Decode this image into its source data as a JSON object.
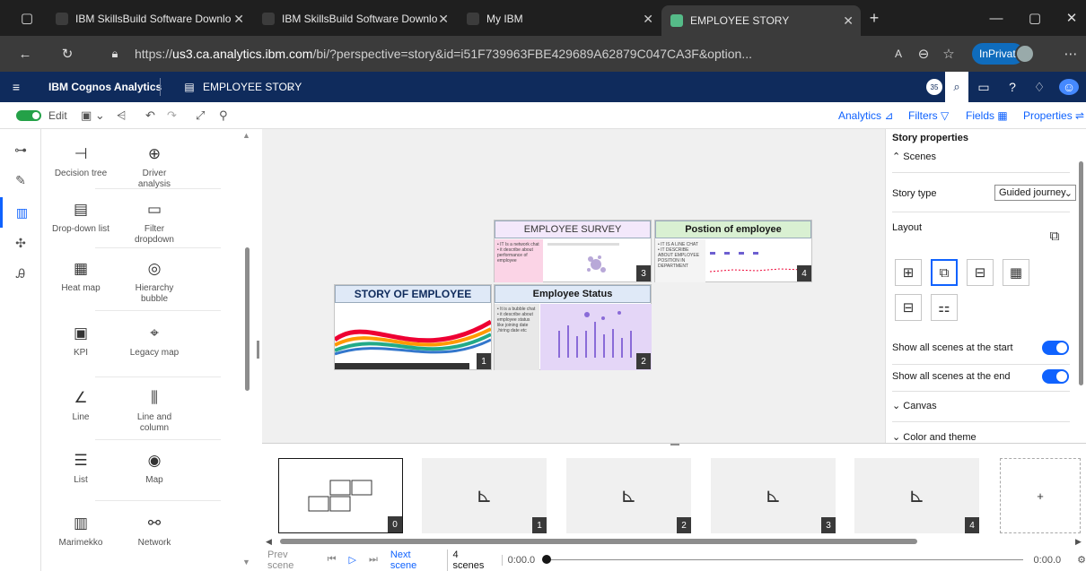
{
  "browser": {
    "tabs": [
      {
        "label": "IBM SkillsBuild Software Downlo"
      },
      {
        "label": "IBM SkillsBuild Software Downlo"
      },
      {
        "label": "My IBM"
      },
      {
        "label": "EMPLOYEE STORY"
      }
    ],
    "url_prefix": "https://",
    "url_host": "us3.ca.analytics.ibm.com",
    "url_path": "/bi/?perspective=story&id=i51F739963FBE429689A62879C047CA3F&option...",
    "inprivate_label": "InPrivate"
  },
  "app": {
    "product": "IBM Cognos Analytics",
    "document_title": "EMPLOYEE STORY",
    "notification_count": "35"
  },
  "toolbar": {
    "edit_label": "Edit",
    "analytics_label": "Analytics",
    "filters_label": "Filters",
    "fields_label": "Fields",
    "properties_label": "Properties"
  },
  "palette": {
    "items": [
      {
        "label": "Decision tree",
        "icon": "decision-tree-icon",
        "glyph": "⊣"
      },
      {
        "label": "Driver analysis",
        "icon": "driver-analysis-icon",
        "glyph": "⊕"
      },
      {
        "label": "Drop-down list",
        "icon": "dropdown-list-icon",
        "glyph": "▤"
      },
      {
        "label": "Filter dropdown",
        "icon": "filter-dropdown-icon",
        "glyph": "▭"
      },
      {
        "label": "Heat map",
        "icon": "heat-map-icon",
        "glyph": "▦"
      },
      {
        "label": "Hierarchy bubble",
        "icon": "hierarchy-bubble-icon",
        "glyph": "◎"
      },
      {
        "label": "KPI",
        "icon": "kpi-icon",
        "glyph": "▣"
      },
      {
        "label": "Legacy map",
        "icon": "legacy-map-icon",
        "glyph": "⌖"
      },
      {
        "label": "Line",
        "icon": "line-chart-icon",
        "glyph": "∠"
      },
      {
        "label": "Line and column",
        "icon": "line-and-column-icon",
        "glyph": "⫼"
      },
      {
        "label": "List",
        "icon": "list-icon",
        "glyph": "☰"
      },
      {
        "label": "Map",
        "icon": "map-icon",
        "glyph": "◉"
      },
      {
        "label": "Marimekko",
        "icon": "marimekko-icon",
        "glyph": "▥"
      },
      {
        "label": "Network",
        "icon": "network-icon",
        "glyph": "⚯"
      }
    ]
  },
  "canvas": {
    "scenes": [
      {
        "title": "STORY OF EMPLOYEE",
        "number": "1",
        "bullets": []
      },
      {
        "title": "Employee Status",
        "number": "2",
        "bullets": [
          "It is a bubble chat",
          "it describe about employee status like joining date ,hiring date etc"
        ]
      },
      {
        "title": "EMPLOYEE SURVEY",
        "number": "3",
        "bullets": [
          "IT Is a network chat",
          "it describe about performance of employee"
        ]
      },
      {
        "title": "Postion of employee",
        "number": "4",
        "bullets": [
          "IT IS A LINE CHAT",
          "IT DESCRIBE ABOUT EMPLOYEE POSITION IN DEPARTMENT"
        ]
      }
    ]
  },
  "properties": {
    "title": "Story properties",
    "scenes_section": "Scenes",
    "story_type_label": "Story type",
    "story_type_value": "Guided journey",
    "layout_label": "Layout",
    "show_start_label": "Show all scenes at the start",
    "show_end_label": "Show all scenes at the end",
    "canvas_section": "Canvas",
    "color_section": "Color and theme"
  },
  "timeline": {
    "thumb_numbers": [
      "0",
      "1",
      "2",
      "3",
      "4"
    ],
    "add_label": "+",
    "prev_label": "Prev scene",
    "next_label": "Next scene",
    "scenes_count": "4 scenes",
    "start_time": "0:00.0",
    "end_time": "0:00.0"
  },
  "colors": {
    "brand_bar": "#0f2b5c",
    "accent": "#0f62fe",
    "survey_bg": "#f3e8fb",
    "status_bg": "#dfe9f7",
    "position_bg": "#d9f0d2"
  }
}
